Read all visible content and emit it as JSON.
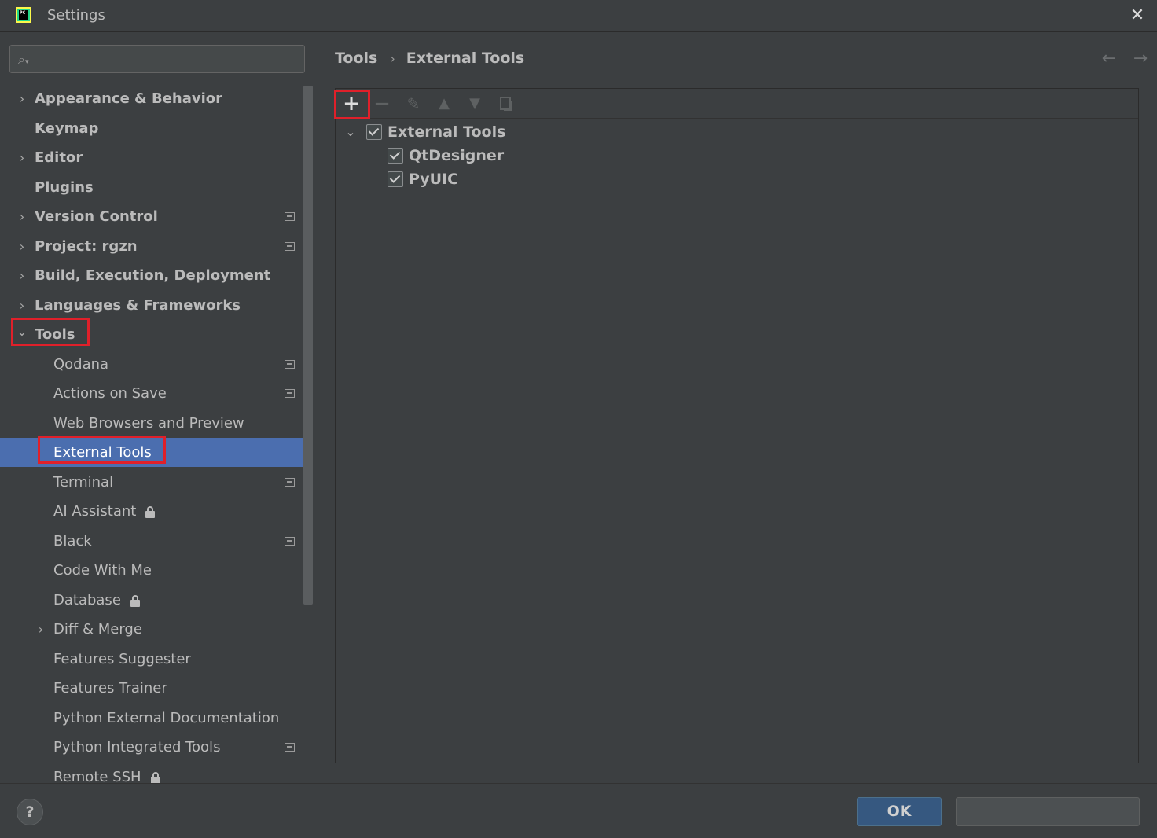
{
  "window": {
    "title": "Settings",
    "logo_text": "PC"
  },
  "search": {
    "value": "",
    "placeholder": ""
  },
  "sidebar": {
    "items": [
      {
        "label": "Appearance & Behavior",
        "level": 0,
        "expandable": true,
        "expanded": false
      },
      {
        "label": "Keymap",
        "level": 0,
        "expandable": false
      },
      {
        "label": "Editor",
        "level": 0,
        "expandable": true,
        "expanded": false
      },
      {
        "label": "Plugins",
        "level": 0,
        "expandable": false
      },
      {
        "label": "Version Control",
        "level": 0,
        "expandable": true,
        "expanded": false,
        "project_icon": true
      },
      {
        "label": "Project: rgzn",
        "level": 0,
        "expandable": true,
        "expanded": false,
        "project_icon": true
      },
      {
        "label": "Build, Execution, Deployment",
        "level": 0,
        "expandable": true,
        "expanded": false
      },
      {
        "label": "Languages & Frameworks",
        "level": 0,
        "expandable": true,
        "expanded": false
      },
      {
        "label": "Tools",
        "level": 0,
        "expandable": true,
        "expanded": true,
        "highlighted": true
      },
      {
        "label": "Qodana",
        "level": 1,
        "project_icon": true
      },
      {
        "label": "Actions on Save",
        "level": 1,
        "project_icon": true
      },
      {
        "label": "Web Browsers and Preview",
        "level": 1
      },
      {
        "label": "External Tools",
        "level": 1,
        "selected": true,
        "highlighted": true
      },
      {
        "label": "Terminal",
        "level": 1,
        "project_icon": true
      },
      {
        "label": "AI Assistant",
        "level": 1,
        "locked": true
      },
      {
        "label": "Black",
        "level": 1,
        "project_icon": true
      },
      {
        "label": "Code With Me",
        "level": 1
      },
      {
        "label": "Database",
        "level": 1,
        "locked": true
      },
      {
        "label": "Diff & Merge",
        "level": 1,
        "expandable": true,
        "expanded": false
      },
      {
        "label": "Features Suggester",
        "level": 1
      },
      {
        "label": "Features Trainer",
        "level": 1
      },
      {
        "label": "Python External Documentation",
        "level": 1
      },
      {
        "label": "Python Integrated Tools",
        "level": 1,
        "project_icon": true
      },
      {
        "label": "Remote SSH",
        "level": 1,
        "locked": true
      }
    ]
  },
  "breadcrumb": {
    "parent": "Tools",
    "separator": "›",
    "current": "External Tools"
  },
  "toolbar": {
    "add": "+",
    "remove": "−",
    "edit": "✎",
    "up": "▲",
    "down": "▼"
  },
  "tools_tree": {
    "group": {
      "name": "External Tools",
      "checked": true,
      "expanded": true
    },
    "children": [
      {
        "name": "QtDesigner",
        "checked": true
      },
      {
        "name": "PyUIC",
        "checked": true
      }
    ]
  },
  "footer": {
    "help": "?",
    "ok_label": "OK",
    "cancel_label": ""
  },
  "colors": {
    "background": "#3c3f41",
    "selection": "#4b6eaf",
    "highlight_box": "#e0202a",
    "ok_button": "#365880"
  },
  "icons": [
    "app-logo-icon",
    "close-icon",
    "search-icon",
    "chevron-right-icon",
    "chevron-down-icon",
    "project-scope-icon",
    "lock-icon",
    "arrow-left-icon",
    "arrow-right-icon",
    "add-icon",
    "remove-icon",
    "edit-icon",
    "move-up-icon",
    "move-down-icon",
    "copy-icon",
    "help-icon"
  ]
}
